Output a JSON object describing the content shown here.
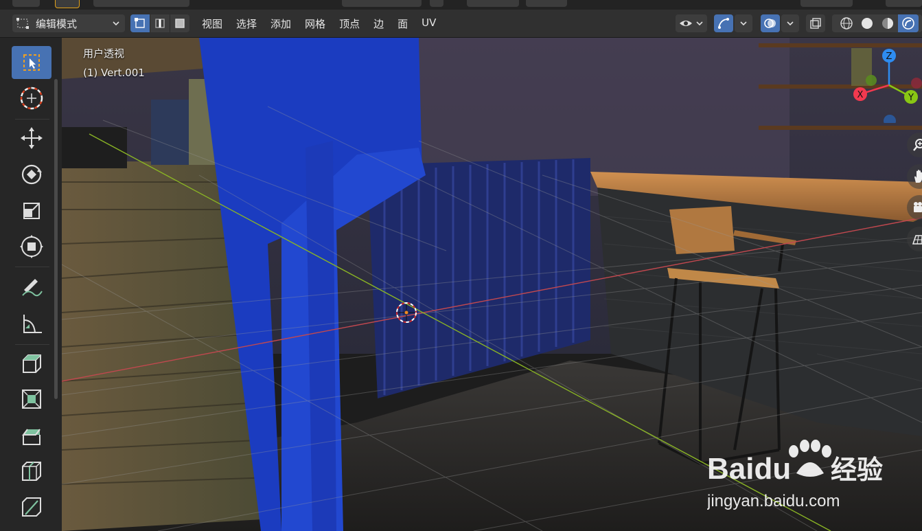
{
  "header": {
    "mode_label": "编辑模式",
    "menus": [
      "视图",
      "选择",
      "添加",
      "网格",
      "顶点",
      "边",
      "面",
      "UV"
    ]
  },
  "viewport": {
    "view_name": "用户透视",
    "object_name": "(1) Vert.001"
  },
  "gizmo": {
    "x": "X",
    "y": "Y",
    "z": "Z"
  },
  "watermark": {
    "brand": "Baidu",
    "suffix": "经验",
    "url": "jingyan.baidu.com"
  },
  "colors": {
    "accent": "#4772b3",
    "x_axis": "#f3394f",
    "y_axis": "#89c714",
    "z_axis": "#2e8cf0"
  },
  "icons": [
    "editmode-icon",
    "vertex-select-icon",
    "edge-select-icon",
    "face-select-icon",
    "select-box-icon",
    "cursor-icon",
    "move-icon",
    "rotate-icon",
    "scale-icon",
    "transform-icon",
    "annotate-icon",
    "measure-icon",
    "extrude-icon",
    "inset-icon",
    "bevel-icon",
    "loopcut-icon",
    "knife-icon",
    "zoom-icon",
    "hand-icon",
    "camera-icon",
    "grid-icon"
  ]
}
